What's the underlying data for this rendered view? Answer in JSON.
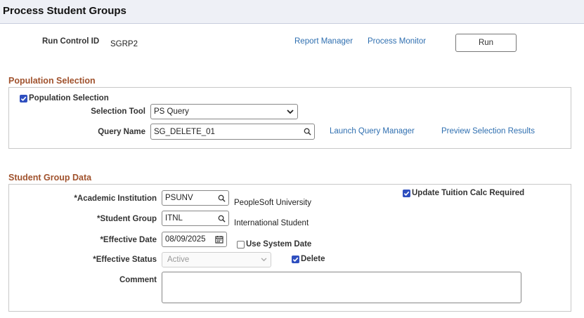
{
  "header": {
    "title": "Process Student Groups"
  },
  "run_control": {
    "label": "Run Control ID",
    "value": "SGRP2",
    "report_manager": "Report Manager",
    "process_monitor": "Process Monitor",
    "run_button": "Run"
  },
  "population": {
    "section_title": "Population Selection",
    "checkbox_label": "Population Selection",
    "checkbox_checked": true,
    "selection_tool_label": "Selection Tool",
    "selection_tool_value": "PS Query",
    "query_name_label": "Query Name",
    "query_name_value": "SG_DELETE_01",
    "launch_query_manager": "Launch Query Manager",
    "preview_selection_results": "Preview Selection Results"
  },
  "student_group": {
    "section_title": "Student Group Data",
    "academic_institution_label": "*Academic Institution",
    "academic_institution_value": "PSUNV",
    "academic_institution_desc": "PeopleSoft University",
    "student_group_label": "*Student Group",
    "student_group_value": "ITNL",
    "student_group_desc": "International Student",
    "effective_date_label": "*Effective Date",
    "effective_date_value": "08/09/2025",
    "use_system_date_label": "Use System Date",
    "use_system_date_checked": false,
    "effective_status_label": "*Effective Status",
    "effective_status_value": "Active",
    "delete_label": "Delete",
    "delete_checked": true,
    "update_tuition_label": "Update Tuition Calc Required",
    "update_tuition_checked": true,
    "comment_label": "Comment",
    "comment_value": ""
  },
  "icons": {
    "search": "search-icon",
    "calendar": "calendar-icon",
    "dropdown": "chevron-down-icon",
    "check": "checkmark-icon"
  },
  "colors": {
    "link": "#2f6fb0",
    "section_title": "#a0522d",
    "checkbox": "#2f4fbf",
    "header_bg": "#eef0f6"
  }
}
